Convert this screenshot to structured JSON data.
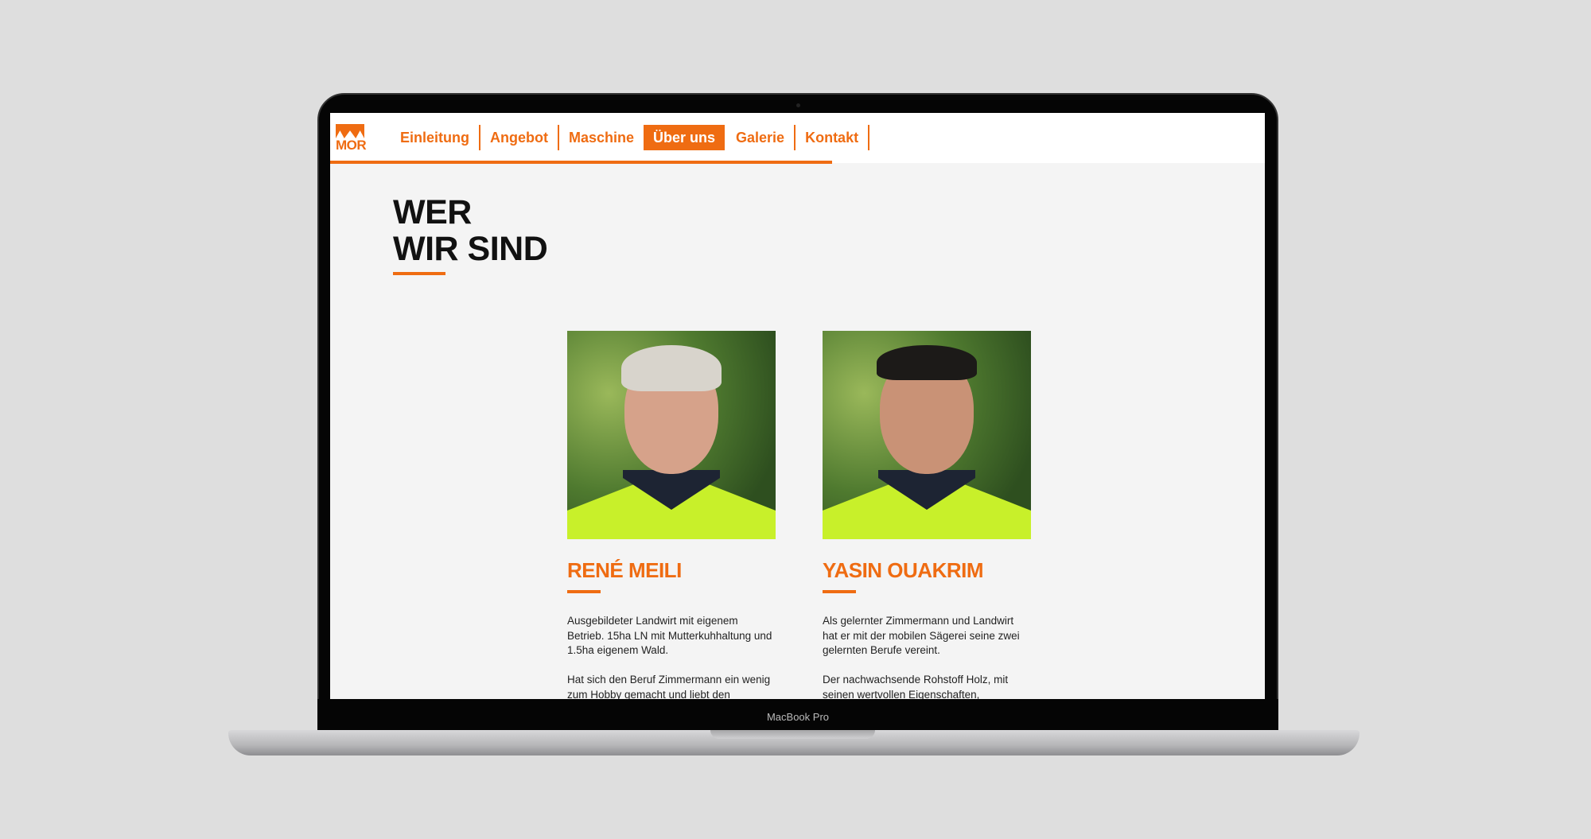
{
  "device_label": "MacBook Pro",
  "logo": {
    "text": "MOR"
  },
  "nav": {
    "items": [
      {
        "label": "Einleitung"
      },
      {
        "label": "Angebot"
      },
      {
        "label": "Maschine"
      },
      {
        "label": "Über uns",
        "active": true
      },
      {
        "label": "Galerie"
      },
      {
        "label": "Kontakt"
      }
    ]
  },
  "heading": {
    "line1": "WER",
    "line2": "WIR SIND"
  },
  "team": [
    {
      "name": "RENÉ MEILI",
      "p1": "Ausgebildeter Landwirt mit eigenem Betrieb. 15ha LN mit Mutterkuhhaltung und 1.5ha eigenem Wald.",
      "p2": "Hat sich den Beruf Zimmermann ein wenig zum Hobby gemacht und liebt den"
    },
    {
      "name": "YASIN OUAKRIM",
      "p1": "Als gelernter Zimmermann und Landwirt hat er mit der mobilen Sägerei seine zwei gelernten Berufe vereint.",
      "p2": "Der nachwachsende Rohstoff Holz, mit seinen wertvollen Eigenschaften,"
    }
  ],
  "colors": {
    "accent": "#ef6c12"
  }
}
